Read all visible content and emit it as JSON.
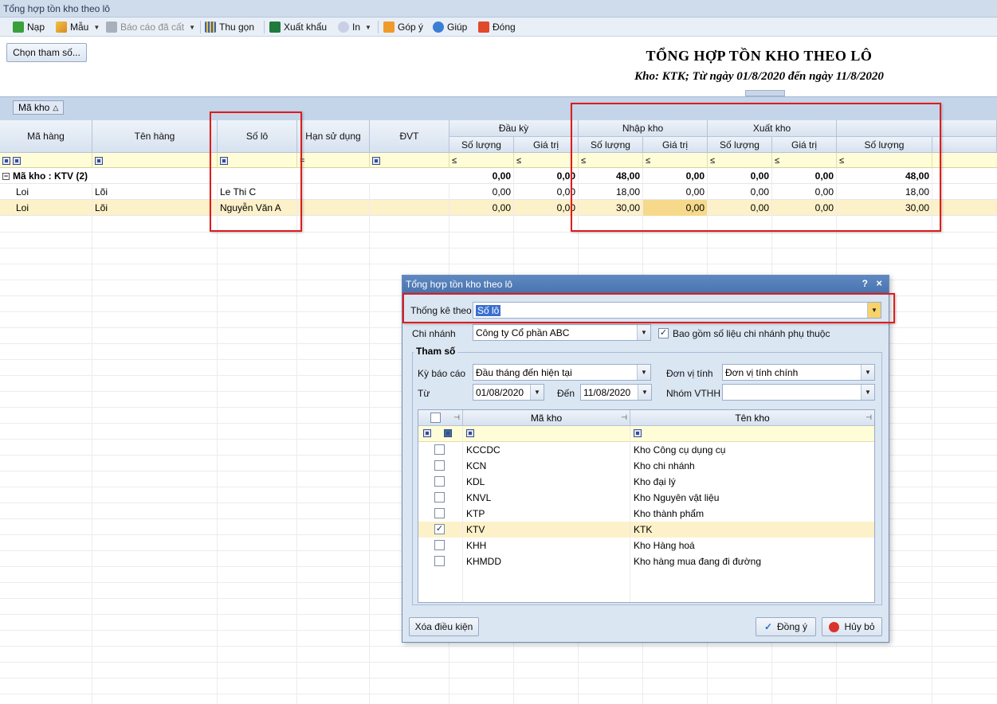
{
  "window": {
    "title": "Tổng hợp tồn kho theo lô"
  },
  "toolbar": {
    "reload": "Nạp",
    "template": "Mẫu",
    "saved_reports": "Báo cáo đã cất",
    "collapse": "Thu gọn",
    "export": "Xuất khẩu",
    "print": "In",
    "feedback": "Góp ý",
    "help": "Giúp",
    "close": "Đóng"
  },
  "params_button": "Chọn tham số...",
  "report": {
    "title": "TỔNG HỢP TỒN KHO THEO LÔ",
    "subtitle": "Kho: KTK; Từ ngày 01/8/2020 đến ngày 11/8/2020"
  },
  "group_panel": {
    "chip": "Mã kho"
  },
  "grid": {
    "columns": {
      "ma_hang": "Mã hàng",
      "ten_hang": "Tên hàng",
      "so_lo": "Số lô",
      "han_su_dung": "Hạn sử dụng",
      "dvt": "ĐVT",
      "dau_ky": "Đầu kỳ",
      "nhap_kho": "Nhập kho",
      "xuat_kho": "Xuất kho",
      "so_luong": "Số lượng",
      "gia_tri": "Giá trị"
    },
    "filter_ops": {
      "eq": "=",
      "le": "≤"
    },
    "group_row": {
      "label": "Mã kho : KTV (2)",
      "values": [
        "0,00",
        "0,00",
        "48,00",
        "0,00",
        "0,00",
        "0,00",
        "48,00"
      ]
    },
    "rows": [
      {
        "ma_hang": "Loi",
        "ten_hang": "Lõi",
        "so_lo": "Le Thi C",
        "values": [
          "0,00",
          "0,00",
          "18,00",
          "0,00",
          "0,00",
          "0,00",
          "18,00"
        ]
      },
      {
        "ma_hang": "Loi",
        "ten_hang": "Lõi",
        "so_lo": "Nguyễn Văn A",
        "values": [
          "0,00",
          "0,00",
          "30,00",
          "0,00",
          "0,00",
          "0,00",
          "30,00"
        ]
      }
    ]
  },
  "dialog": {
    "title": "Tổng hợp tồn kho theo lô",
    "help": "?",
    "close": "×",
    "thong_ke_theo_label": "Thống kê theo",
    "thong_ke_theo_value": "Số lô",
    "chi_nhanh_label": "Chi nhánh",
    "chi_nhanh_value": "Công ty Cổ phần ABC",
    "include_branch_label": "Bao gồm số liệu chi nhánh phụ thuộc",
    "include_branch_checked": true,
    "group_title": "Tham số",
    "ky_bao_cao_label": "Kỳ báo cáo",
    "ky_bao_cao_value": "Đầu tháng đến hiện tại",
    "don_vi_tinh_label": "Đơn vị tính",
    "don_vi_tinh_value": "Đơn vị tính chính",
    "tu_label": "Từ",
    "tu_value": "01/08/2020",
    "den_label": "Đến",
    "den_value": "11/08/2020",
    "nhom_vthh_label": "Nhóm VTHH",
    "nhom_vthh_value": "",
    "kho_grid": {
      "col_ma_kho": "Mã kho",
      "col_ten_kho": "Tên kho",
      "rows": [
        {
          "ma": "KCCDC",
          "ten": "Kho Công cụ dụng cụ",
          "checked": false
        },
        {
          "ma": "KCN",
          "ten": "Kho chi nhánh",
          "checked": false
        },
        {
          "ma": "KDL",
          "ten": "Kho đại lý",
          "checked": false
        },
        {
          "ma": "KNVL",
          "ten": "Kho Nguyên vật liệu",
          "checked": false
        },
        {
          "ma": "KTP",
          "ten": "Kho thành phẩm",
          "checked": false
        },
        {
          "ma": "KTV",
          "ten": "KTK",
          "checked": true
        },
        {
          "ma": "KHH",
          "ten": "Kho Hàng hoá",
          "checked": false
        },
        {
          "ma": "KHMDD",
          "ten": "Kho hàng mua đang đi đường",
          "checked": false
        }
      ]
    },
    "clear_button": "Xóa điều kiện",
    "ok_button": "Đồng ý",
    "cancel_button": "Hủy bỏ"
  },
  "colors": {
    "highlight_red": "#e01b1b",
    "selected_row": "#fdf1c9",
    "filter_row": "#fffdd7",
    "dialog_title": "#5e88c2"
  }
}
